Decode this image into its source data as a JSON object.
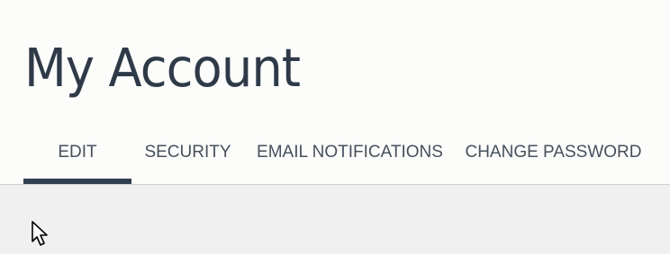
{
  "page": {
    "title": "My Account"
  },
  "tabs": [
    {
      "label": "EDIT",
      "active": true
    },
    {
      "label": "SECURITY",
      "active": false
    },
    {
      "label": "EMAIL NOTIFICATIONS",
      "active": false
    },
    {
      "label": "CHANGE PASSWORD",
      "active": false
    }
  ],
  "colors": {
    "header_background": "#fcfcfa",
    "content_background": "#f0f0f0",
    "title_text": "#2e3a48",
    "tab_text": "#46505c",
    "active_tab_underline": "#323f4f",
    "divider": "#cfcfcf"
  },
  "icons": {
    "cursor": "mouse-pointer-icon"
  }
}
